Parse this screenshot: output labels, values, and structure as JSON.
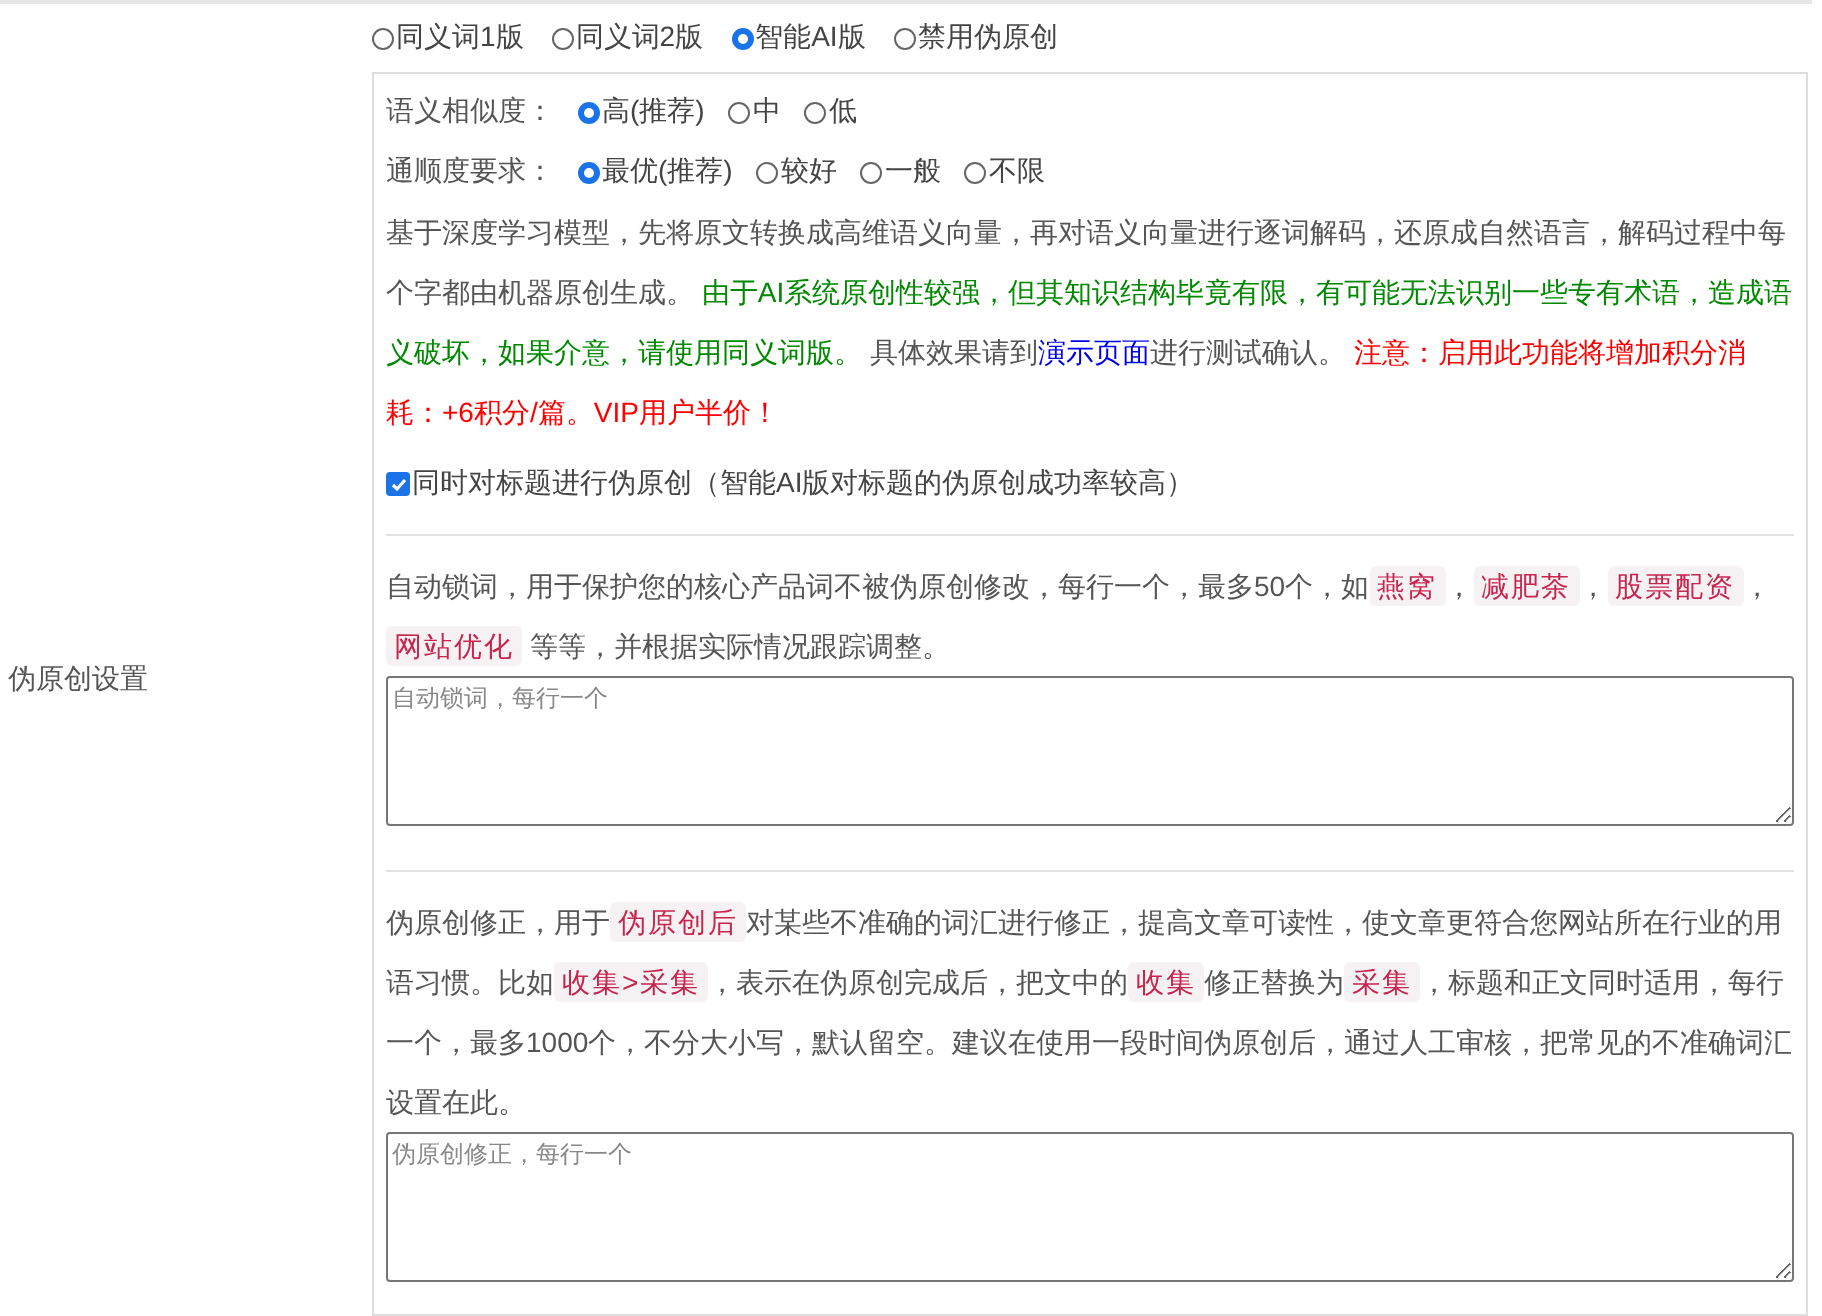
{
  "section_label": "伪原创设置",
  "mode_options": [
    {
      "label": "同义词1版",
      "selected": false
    },
    {
      "label": "同义词2版",
      "selected": false
    },
    {
      "label": "智能AI版",
      "selected": true
    },
    {
      "label": "禁用伪原创",
      "selected": false
    }
  ],
  "similarity": {
    "label": "语义相似度：",
    "options": [
      {
        "label": "高(推荐)",
        "selected": true
      },
      {
        "label": "中",
        "selected": false
      },
      {
        "label": "低",
        "selected": false
      }
    ]
  },
  "fluency": {
    "label": "通顺度要求：",
    "options": [
      {
        "label": "最优(推荐)",
        "selected": true
      },
      {
        "label": "较好",
        "selected": false
      },
      {
        "label": "一般",
        "selected": false
      },
      {
        "label": "不限",
        "selected": false
      }
    ]
  },
  "description": [
    {
      "kind": "plain",
      "text": "基于深度学习模型，先将原文转换成高维语义向量，再对语义向量进行逐词解码，还原成自然语言，解码过程中每个字都由机器原创生成。 "
    },
    {
      "kind": "note",
      "text": "由于AI系统原创性较强，但其知识结构毕竟有限，有可能无法识别一些专有术语，造成语义破坏，如果介意，请使用同义词版。"
    },
    {
      "kind": "plain",
      "text": " 具体效果请到"
    },
    {
      "kind": "link",
      "text": "演示页面"
    },
    {
      "kind": "plain",
      "text": "进行测试确认。 "
    },
    {
      "kind": "warning",
      "text": "注意：启用此功能将增加积分消耗：+6积分/篇。VIP用户半价！"
    }
  ],
  "title_rewrite": {
    "label": "同时对标题进行伪原创（智能AI版对标题的伪原创成功率较高）",
    "checked": true
  },
  "lock_words": {
    "segments": [
      {
        "kind": "text",
        "text": "自动锁词，用于保护您的核心产品词不被伪原创修改，每行一个，最多50个，如"
      },
      {
        "kind": "tag",
        "text": "燕窝"
      },
      {
        "kind": "text",
        "text": "，"
      },
      {
        "kind": "tag",
        "text": "减肥茶"
      },
      {
        "kind": "text",
        "text": "，"
      },
      {
        "kind": "tag",
        "text": "股票配资"
      },
      {
        "kind": "text",
        "text": "，"
      },
      {
        "kind": "tag",
        "text": "网站优化"
      },
      {
        "kind": "text",
        "text": " 等等，并根据实际情况跟踪调整。"
      }
    ],
    "placeholder": "自动锁词，每行一个"
  },
  "correction": {
    "segments": [
      {
        "kind": "text",
        "text": "伪原创修正，用于"
      },
      {
        "kind": "tag",
        "text": "伪原创后"
      },
      {
        "kind": "text",
        "text": "对某些不准确的词汇进行修正，提高文章可读性，使文章更符合您网站所在行业的用语习惯。比如"
      },
      {
        "kind": "tag",
        "text": "收集>采集"
      },
      {
        "kind": "text",
        "text": "，表示在伪原创完成后，把文中的"
      },
      {
        "kind": "tag",
        "text": "收集"
      },
      {
        "kind": "text",
        "text": "修正替换为"
      },
      {
        "kind": "tag",
        "text": "采集"
      },
      {
        "kind": "text",
        "text": "，标题和正文同时适用，每行一个，最多1000个，不分大小写，默认留空。建议在使用一段时间伪原创后，通过人工审核，把常见的不准确词汇设置在此。"
      }
    ],
    "placeholder": "伪原创修正，每行一个"
  }
}
